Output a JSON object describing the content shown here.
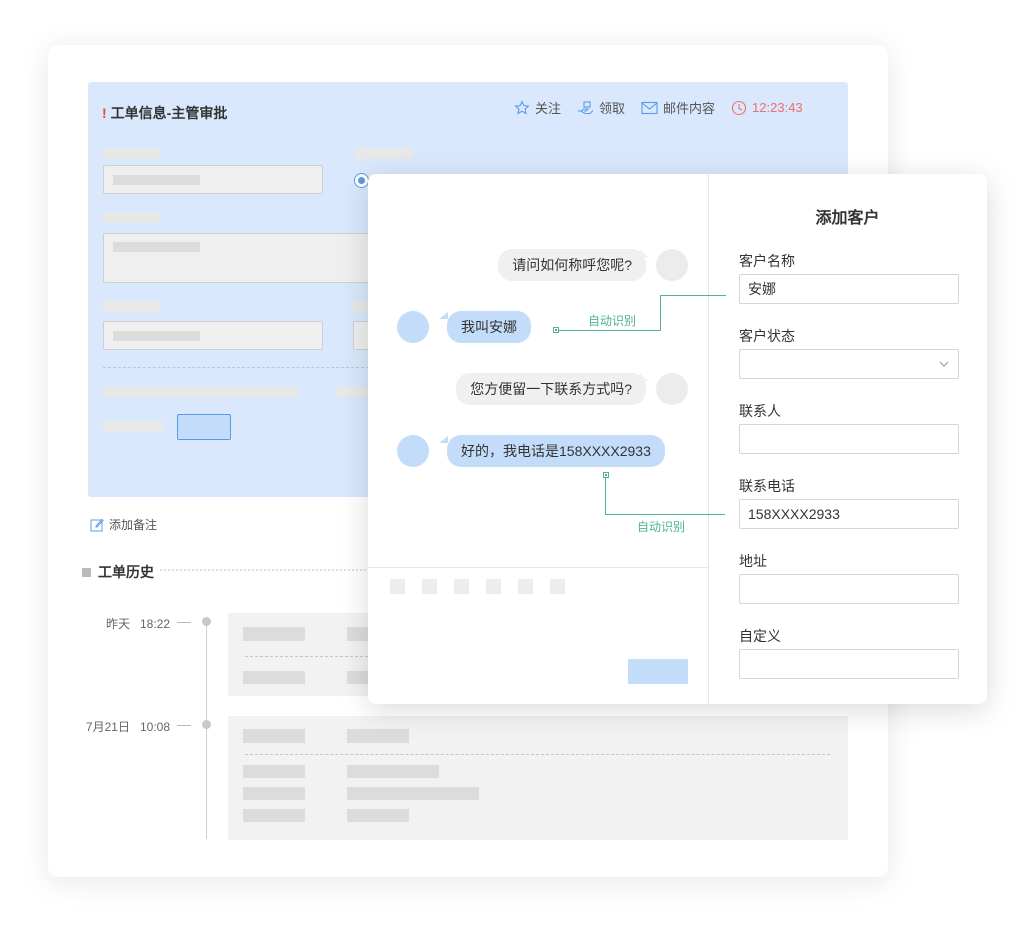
{
  "ticket": {
    "title_mark": "!",
    "title": "工单信息-主管审批",
    "toolbar": {
      "follow": "关注",
      "claim": "领取",
      "email": "邮件内容",
      "time": "12:23:43"
    },
    "add_remark": "添加备注",
    "history_title": "工单历史",
    "history": [
      {
        "date": "昨天",
        "time": "18:22"
      },
      {
        "date": "7月21日",
        "time": "10:08"
      }
    ]
  },
  "chat": {
    "messages": [
      {
        "from": "agent",
        "text": "请问如何称呼您呢?"
      },
      {
        "from": "customer",
        "text": "我叫安娜"
      },
      {
        "from": "agent",
        "text": "您方便留一下联系方式吗?"
      },
      {
        "from": "customer",
        "text": "好的，我电话是158XXXX2933"
      }
    ],
    "auto_detect_1": "自动识别",
    "auto_detect_2": "自动识别"
  },
  "customer_form": {
    "title": "添加客户",
    "fields": [
      {
        "label": "客户名称",
        "value": "安娜"
      },
      {
        "label": "客户状态",
        "value": ""
      },
      {
        "label": "联系人",
        "value": ""
      },
      {
        "label": "联系电话",
        "value": "158XXXX2933"
      },
      {
        "label": "地址",
        "value": ""
      },
      {
        "label": "自定义",
        "value": ""
      }
    ]
  },
  "colors": {
    "panel_blue": "#d9e8fc",
    "bubble_blue": "#c3dcf9",
    "accent_green": "#4fb38f",
    "alert_red": "#f06e6e",
    "icon_blue": "#5b9be6"
  }
}
